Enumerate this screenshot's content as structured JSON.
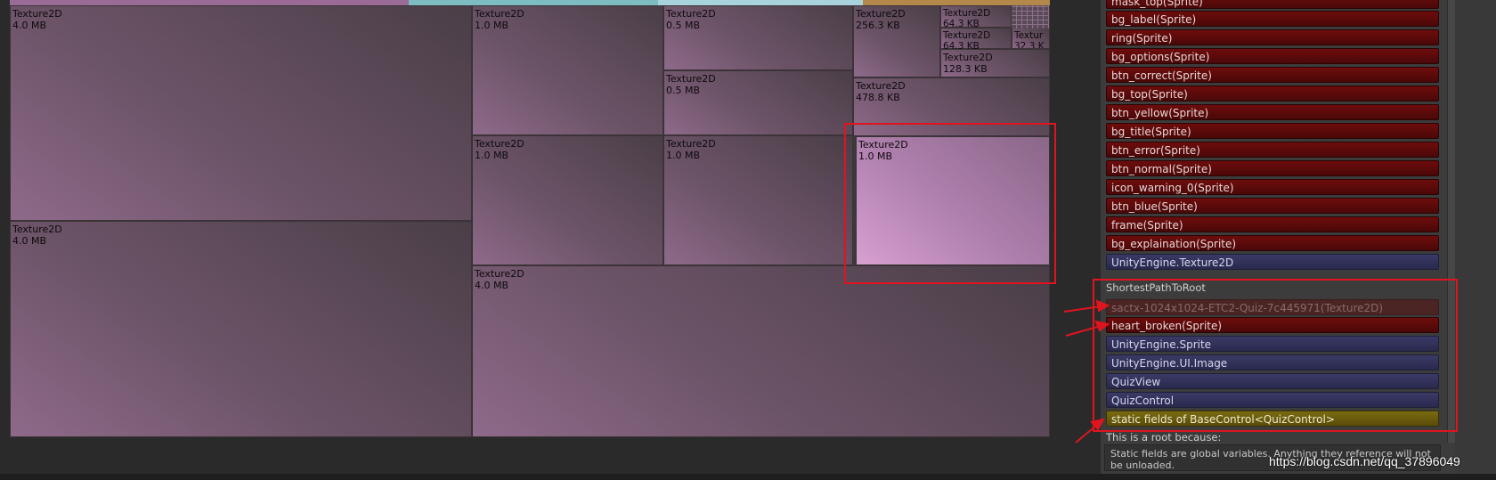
{
  "colors": {
    "sprite": "#5c0a0a",
    "class": "#2e2e58",
    "static_field": "#6a5a0c",
    "highlight": "#e0141e",
    "strip_pink": "#9a6b96",
    "strip_teal": "#7dbcc0",
    "strip_orange": "#b3884a"
  },
  "treemap": {
    "tiles": [
      {
        "type": "Texture2D",
        "size": "4.0 MB"
      },
      {
        "type": "Texture2D",
        "size": "4.0 MB"
      },
      {
        "type": "Texture2D",
        "size": "1.0 MB"
      },
      {
        "type": "Texture2D",
        "size": "1.0 MB"
      },
      {
        "type": "Texture2D",
        "size": "4.0 MB"
      },
      {
        "type": "Texture2D",
        "size": "0.5 MB"
      },
      {
        "type": "Texture2D",
        "size": "0.5 MB"
      },
      {
        "type": "Texture2D",
        "size": "1.0 MB"
      },
      {
        "type": "Texture2D",
        "size": "256.3 KB"
      },
      {
        "type": "Texture2D",
        "size": "478.8 KB"
      },
      {
        "type": "Texture2D",
        "size": "1.0 MB"
      },
      {
        "type": "Texture2D",
        "size": "64.3 KB"
      },
      {
        "type": "Texture2D",
        "size": "64.3 KB"
      },
      {
        "type": "Textur",
        "size": "32.3 K"
      },
      {
        "type": "Texture2D",
        "size": "128.3 KB"
      }
    ]
  },
  "referenced_by": [
    {
      "label": "mask_top(Sprite)",
      "kind": "sprite"
    },
    {
      "label": "bg_label(Sprite)",
      "kind": "sprite"
    },
    {
      "label": "ring(Sprite)",
      "kind": "sprite"
    },
    {
      "label": "bg_options(Sprite)",
      "kind": "sprite"
    },
    {
      "label": "btn_correct(Sprite)",
      "kind": "sprite"
    },
    {
      "label": "bg_top(Sprite)",
      "kind": "sprite"
    },
    {
      "label": "btn_yellow(Sprite)",
      "kind": "sprite"
    },
    {
      "label": "bg_title(Sprite)",
      "kind": "sprite"
    },
    {
      "label": "btn_error(Sprite)",
      "kind": "sprite"
    },
    {
      "label": "btn_normal(Sprite)",
      "kind": "sprite"
    },
    {
      "label": "icon_warning_0(Sprite)",
      "kind": "sprite"
    },
    {
      "label": "btn_blue(Sprite)",
      "kind": "sprite"
    },
    {
      "label": "frame(Sprite)",
      "kind": "sprite"
    },
    {
      "label": "bg_explaination(Sprite)",
      "kind": "sprite"
    },
    {
      "label": "UnityEngine.Texture2D",
      "kind": "class"
    }
  ],
  "shortest_path": {
    "title": "ShortestPathToRoot",
    "items": [
      {
        "label": "sactx-1024x1024-ETC2-Quiz-7c445971(Texture2D)",
        "kind": "dim"
      },
      {
        "label": "heart_broken(Sprite)",
        "kind": "sprite"
      },
      {
        "label": "UnityEngine.Sprite",
        "kind": "class"
      },
      {
        "label": "UnityEngine.UI.Image",
        "kind": "class"
      },
      {
        "label": "QuizView",
        "kind": "class"
      },
      {
        "label": "QuizControl",
        "kind": "class"
      },
      {
        "label": "static fields of BaseControl<QuizControl>",
        "kind": "static"
      }
    ]
  },
  "root_reason": {
    "heading": "This is a root because:",
    "text": "Static fields are global variables. Anything they reference will not be unloaded."
  },
  "watermark": "https://blog.csdn.net/qq_37896049"
}
